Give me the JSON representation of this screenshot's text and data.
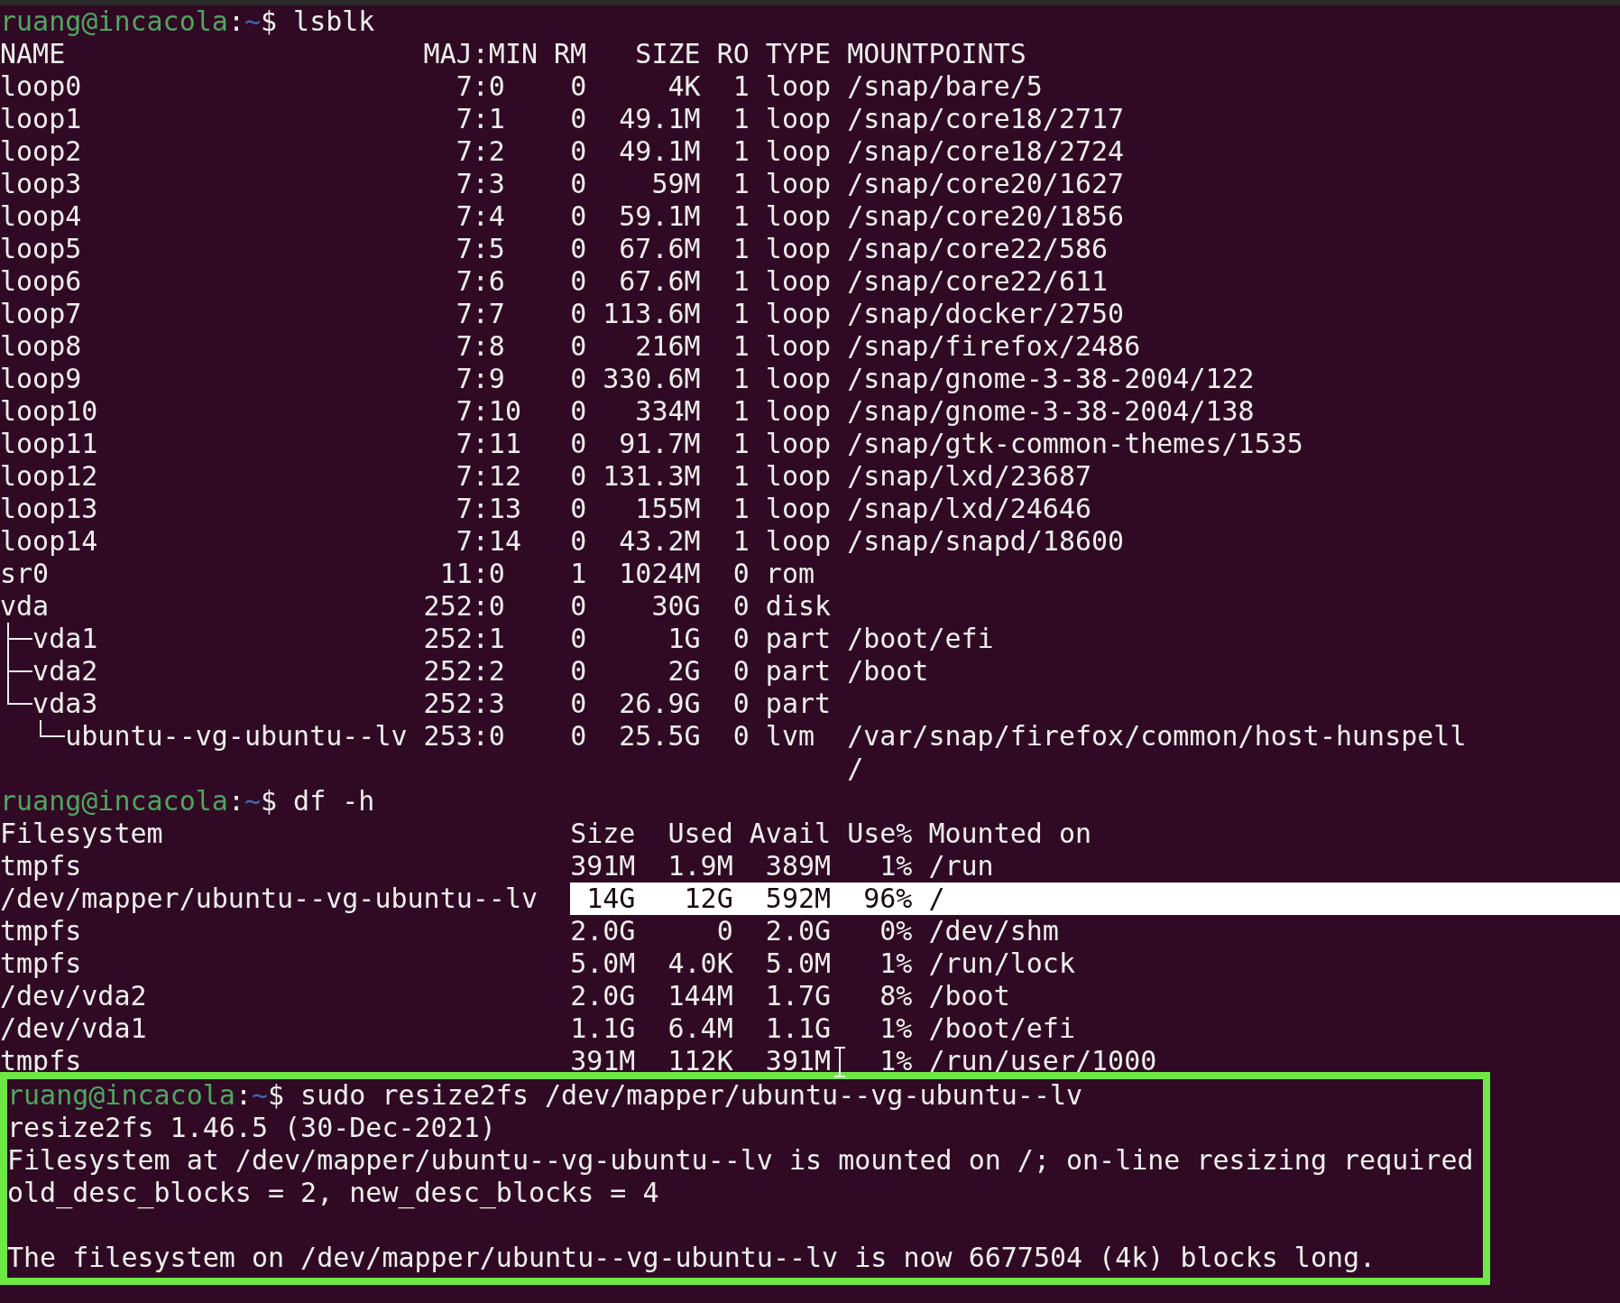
{
  "terminal": {
    "blocks": [
      {
        "kind": "prompt",
        "user_host": "ruang@incacola",
        "separator": ":",
        "path": "~",
        "symbol": "$",
        "command": "lsblk"
      },
      {
        "kind": "lsblk",
        "columns": [
          "NAME",
          "MAJ:MIN",
          "RM",
          "SIZE",
          "RO",
          "TYPE",
          "MOUNTPOINTS"
        ],
        "rows": [
          {
            "name": "loop0",
            "maj_min": "7:0",
            "rm": "0",
            "size": "4K",
            "ro": "1",
            "type": "loop",
            "mountpoints": [
              "/snap/bare/5"
            ]
          },
          {
            "name": "loop1",
            "maj_min": "7:1",
            "rm": "0",
            "size": "49.1M",
            "ro": "1",
            "type": "loop",
            "mountpoints": [
              "/snap/core18/2717"
            ]
          },
          {
            "name": "loop2",
            "maj_min": "7:2",
            "rm": "0",
            "size": "49.1M",
            "ro": "1",
            "type": "loop",
            "mountpoints": [
              "/snap/core18/2724"
            ]
          },
          {
            "name": "loop3",
            "maj_min": "7:3",
            "rm": "0",
            "size": "59M",
            "ro": "1",
            "type": "loop",
            "mountpoints": [
              "/snap/core20/1627"
            ]
          },
          {
            "name": "loop4",
            "maj_min": "7:4",
            "rm": "0",
            "size": "59.1M",
            "ro": "1",
            "type": "loop",
            "mountpoints": [
              "/snap/core20/1856"
            ]
          },
          {
            "name": "loop5",
            "maj_min": "7:5",
            "rm": "0",
            "size": "67.6M",
            "ro": "1",
            "type": "loop",
            "mountpoints": [
              "/snap/core22/586"
            ]
          },
          {
            "name": "loop6",
            "maj_min": "7:6",
            "rm": "0",
            "size": "67.6M",
            "ro": "1",
            "type": "loop",
            "mountpoints": [
              "/snap/core22/611"
            ]
          },
          {
            "name": "loop7",
            "maj_min": "7:7",
            "rm": "0",
            "size": "113.6M",
            "ro": "1",
            "type": "loop",
            "mountpoints": [
              "/snap/docker/2750"
            ]
          },
          {
            "name": "loop8",
            "maj_min": "7:8",
            "rm": "0",
            "size": "216M",
            "ro": "1",
            "type": "loop",
            "mountpoints": [
              "/snap/firefox/2486"
            ]
          },
          {
            "name": "loop9",
            "maj_min": "7:9",
            "rm": "0",
            "size": "330.6M",
            "ro": "1",
            "type": "loop",
            "mountpoints": [
              "/snap/gnome-3-38-2004/122"
            ]
          },
          {
            "name": "loop10",
            "maj_min": "7:10",
            "rm": "0",
            "size": "334M",
            "ro": "1",
            "type": "loop",
            "mountpoints": [
              "/snap/gnome-3-38-2004/138"
            ]
          },
          {
            "name": "loop11",
            "maj_min": "7:11",
            "rm": "0",
            "size": "91.7M",
            "ro": "1",
            "type": "loop",
            "mountpoints": [
              "/snap/gtk-common-themes/1535"
            ]
          },
          {
            "name": "loop12",
            "maj_min": "7:12",
            "rm": "0",
            "size": "131.3M",
            "ro": "1",
            "type": "loop",
            "mountpoints": [
              "/snap/lxd/23687"
            ]
          },
          {
            "name": "loop13",
            "maj_min": "7:13",
            "rm": "0",
            "size": "155M",
            "ro": "1",
            "type": "loop",
            "mountpoints": [
              "/snap/lxd/24646"
            ]
          },
          {
            "name": "loop14",
            "maj_min": "7:14",
            "rm": "0",
            "size": "43.2M",
            "ro": "1",
            "type": "loop",
            "mountpoints": [
              "/snap/snapd/18600"
            ]
          },
          {
            "name": "sr0",
            "maj_min": "11:0",
            "rm": "1",
            "size": "1024M",
            "ro": "0",
            "type": "rom"
          },
          {
            "name": "vda",
            "maj_min": "252:0",
            "rm": "0",
            "size": "30G",
            "ro": "0",
            "type": "disk",
            "children": [
              {
                "name": "vda1",
                "maj_min": "252:1",
                "rm": "0",
                "size": "1G",
                "ro": "0",
                "type": "part",
                "mountpoints": [
                  "/boot/efi"
                ]
              },
              {
                "name": "vda2",
                "maj_min": "252:2",
                "rm": "0",
                "size": "2G",
                "ro": "0",
                "type": "part",
                "mountpoints": [
                  "/boot"
                ]
              },
              {
                "name": "vda3",
                "maj_min": "252:3",
                "rm": "0",
                "size": "26.9G",
                "ro": "0",
                "type": "part",
                "children": [
                  {
                    "name": "ubuntu--vg-ubuntu--lv",
                    "maj_min": "253:0",
                    "rm": "0",
                    "size": "25.5G",
                    "ro": "0",
                    "type": "lvm",
                    "mountpoints": [
                      "/var/snap/firefox/common/host-hunspell",
                      "/"
                    ]
                  }
                ]
              }
            ]
          }
        ]
      },
      {
        "kind": "prompt",
        "user_host": "ruang@incacola",
        "separator": ":",
        "path": "~",
        "symbol": "$",
        "command": "df -h"
      },
      {
        "kind": "df",
        "columns": [
          "Filesystem",
          "Size",
          "Used",
          "Avail",
          "Use%",
          "Mounted on"
        ],
        "rows": [
          {
            "filesystem": "tmpfs",
            "size": "391M",
            "used": "1.9M",
            "avail": "389M",
            "use": "1%",
            "mounted_on": "/run",
            "selected": false
          },
          {
            "filesystem": "/dev/mapper/ubuntu--vg-ubuntu--lv",
            "size": "14G",
            "used": "12G",
            "avail": "592M",
            "use": "96%",
            "mounted_on": "/",
            "selected": true
          },
          {
            "filesystem": "tmpfs",
            "size": "2.0G",
            "used": "0",
            "avail": "2.0G",
            "use": "0%",
            "mounted_on": "/dev/shm",
            "selected": false
          },
          {
            "filesystem": "tmpfs",
            "size": "5.0M",
            "used": "4.0K",
            "avail": "5.0M",
            "use": "1%",
            "mounted_on": "/run/lock",
            "selected": false
          },
          {
            "filesystem": "/dev/vda2",
            "size": "2.0G",
            "used": "144M",
            "avail": "1.7G",
            "use": "8%",
            "mounted_on": "/boot",
            "selected": false
          },
          {
            "filesystem": "/dev/vda1",
            "size": "1.1G",
            "used": "6.4M",
            "avail": "1.1G",
            "use": "1%",
            "mounted_on": "/boot/efi",
            "selected": false
          },
          {
            "filesystem": "tmpfs",
            "size": "391M",
            "used": "112K",
            "avail": "391M",
            "use": "1%",
            "mounted_on": "/run/user/1000",
            "selected": false
          }
        ]
      }
    ],
    "highlight_box": {
      "blocks": [
        {
          "kind": "prompt",
          "user_host": "ruang@incacola",
          "separator": ":",
          "path": "~",
          "symbol": "$",
          "command": "sudo resize2fs /dev/mapper/ubuntu--vg-ubuntu--lv"
        },
        {
          "kind": "text",
          "text": "resize2fs 1.46.5 (30-Dec-2021)"
        },
        {
          "kind": "text",
          "text": "Filesystem at /dev/mapper/ubuntu--vg-ubuntu--lv is mounted on /; on-line resizing required"
        },
        {
          "kind": "text",
          "text": "old_desc_blocks = 2, new_desc_blocks = 4"
        },
        {
          "kind": "blank"
        },
        {
          "kind": "text",
          "text": "The filesystem on /dev/mapper/ubuntu--vg-ubuntu--lv is now 6677504 (4k) blocks long."
        }
      ]
    }
  }
}
